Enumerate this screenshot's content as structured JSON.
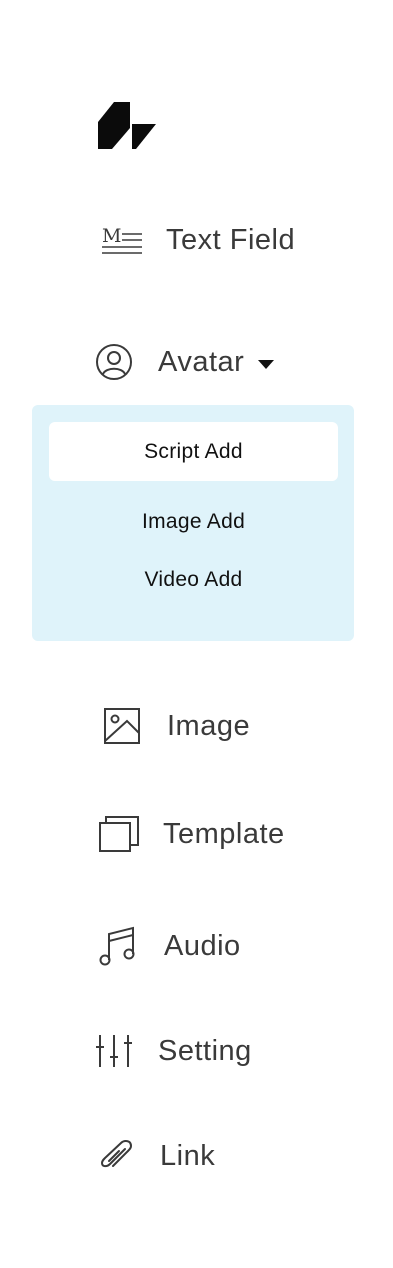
{
  "brand": {
    "logo_icon": "brand-logo"
  },
  "nav": {
    "text_field": {
      "label": "Text Field",
      "icon": "markdown-icon"
    },
    "avatar": {
      "label": "Avatar",
      "icon": "user-circle-icon",
      "expanded": true,
      "submenu": [
        {
          "label": "Script Add",
          "active": true
        },
        {
          "label": "Image Add",
          "active": false
        },
        {
          "label": "Video Add",
          "active": false
        }
      ]
    },
    "image": {
      "label": "Image",
      "icon": "image-icon"
    },
    "template": {
      "label": "Template",
      "icon": "template-icon"
    },
    "audio": {
      "label": "Audio",
      "icon": "music-note-icon"
    },
    "setting": {
      "label": "Setting",
      "icon": "sliders-icon"
    },
    "link": {
      "label": "Link",
      "icon": "paperclip-icon"
    }
  },
  "colors": {
    "submenu_bg": "#dff3fa",
    "text": "#3a3a3a",
    "active_bg": "#ffffff"
  }
}
